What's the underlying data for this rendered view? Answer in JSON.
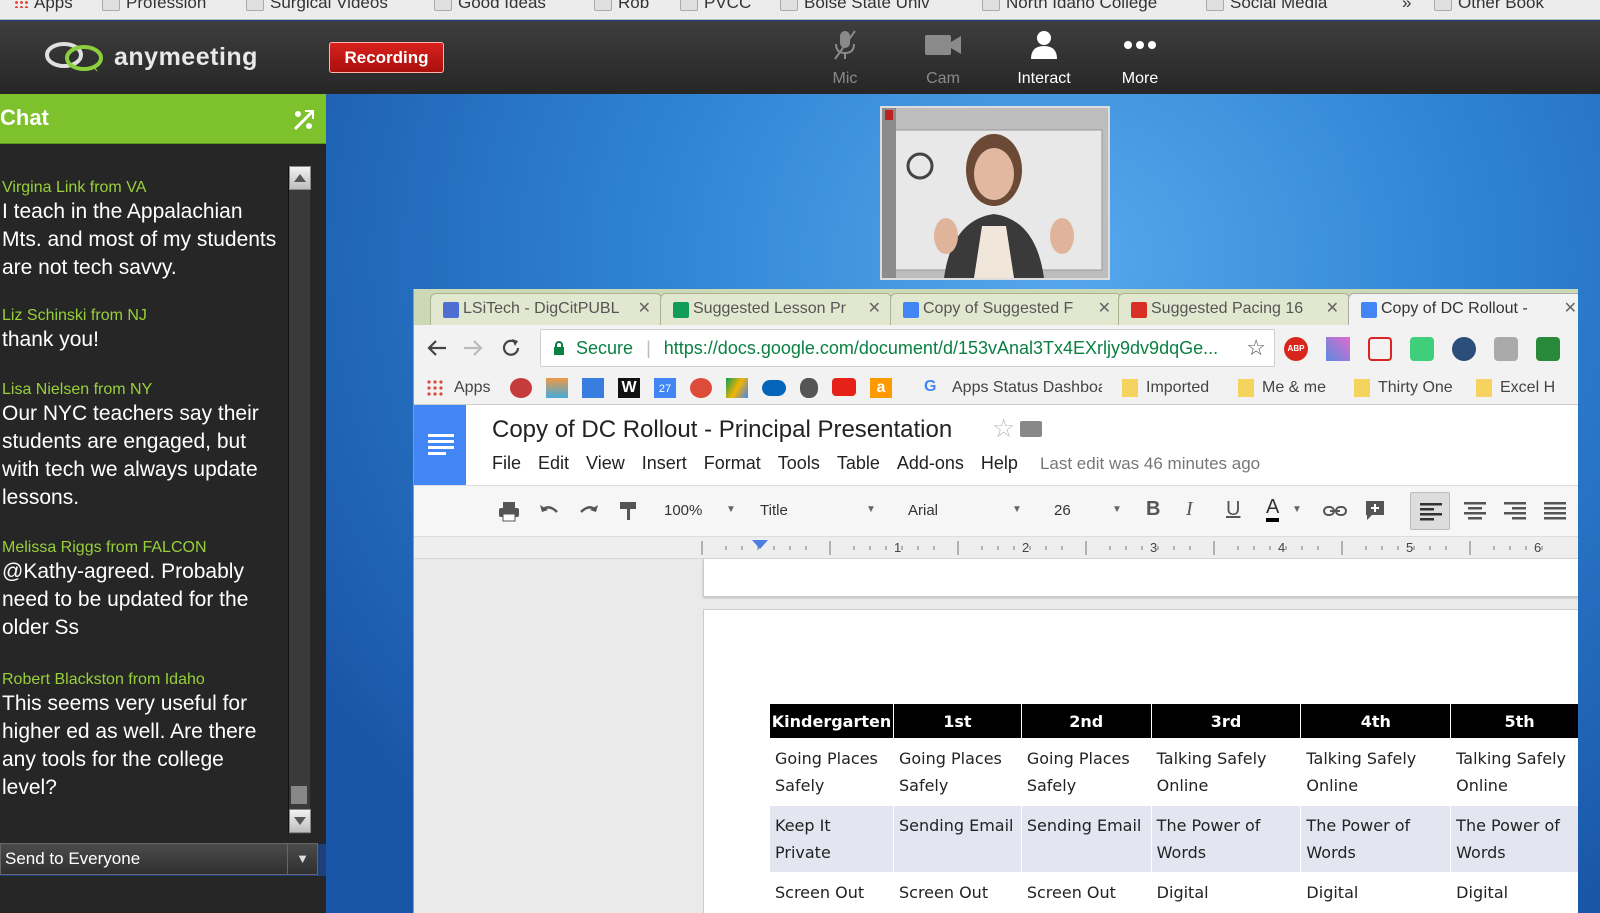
{
  "bookmarks_top": [
    "Apps",
    "Profession",
    "Surgical Videos",
    "Good Ideas",
    "Rob",
    "PVCC",
    "Boise State Univ",
    "North Idaho College",
    "Social Media",
    "»",
    "Other Book"
  ],
  "app": {
    "name": "anymeeting",
    "recording_label": "Recording"
  },
  "toolbar_buttons": [
    {
      "label": "Mic",
      "icon": "mic-muted-icon",
      "state": "disabled"
    },
    {
      "label": "Cam",
      "icon": "camera-icon",
      "state": "disabled"
    },
    {
      "label": "Interact",
      "icon": "person-icon",
      "state": "active"
    },
    {
      "label": "More",
      "icon": "more-dots-icon",
      "state": "active"
    }
  ],
  "chat": {
    "title": "Chat",
    "messages": [
      {
        "from": "Virgina Link from VA",
        "text": "I teach in the Appalachian Mts. and most of my students are not tech savvy."
      },
      {
        "from": "Liz Schinski from NJ",
        "text": "thank you!"
      },
      {
        "from": "Lisa  Nielsen from NY",
        "text": "Our NYC teachers say their students are engaged, but with tech we always update lessons."
      },
      {
        "from": "Melissa Riggs from FALCON",
        "text": "@Kathy-agreed. Probably need to be updated for the older Ss"
      },
      {
        "from": "Robert Blackston from Idaho",
        "text": "This seems very useful for higher ed as well. Are there any tools for the college level?"
      }
    ],
    "send_to": "Send to Everyone"
  },
  "browser": {
    "tabs": [
      {
        "label": "LSiTech - DigCitPUBL",
        "icon_color": "#4c6fd1"
      },
      {
        "label": "Suggested Lesson Pr",
        "icon_color": "#0f9d58"
      },
      {
        "label": "Copy of Suggested F",
        "icon_color": "#4285f4"
      },
      {
        "label": "Suggested Pacing 16",
        "icon_color": "#d93025"
      },
      {
        "label": "Copy of DC Rollout -",
        "icon_color": "#4285f4"
      }
    ],
    "secure_label": "Secure",
    "url": "https://docs.google.com/document/d/153vAnal3Tx4EXrljy9dv9dqGe...",
    "bookmarks": {
      "apps": "Apps",
      "apps_status": "Apps Status Dashboa",
      "imported": "Imported",
      "me": "Me & me",
      "thirty": "Thirty One",
      "excel": "Excel H"
    },
    "doc": {
      "title": "Copy of DC Rollout - Principal Presentation",
      "menus": [
        "File",
        "Edit",
        "View",
        "Insert",
        "Format",
        "Tools",
        "Table",
        "Add-ons",
        "Help"
      ],
      "last_edit": "Last edit was 46 minutes ago",
      "zoom": "100%",
      "style": "Title",
      "font": "Arial",
      "size": "26",
      "ruler_numbers": [
        "1",
        "2",
        "3",
        "4",
        "5",
        "6"
      ],
      "table": {
        "headers": [
          "Kindergarten",
          "1st",
          "2nd",
          "3rd",
          "4th",
          "5th"
        ],
        "rows": [
          [
            "Going Places Safely",
            "Going Places Safely",
            "Going Places Safely",
            "Talking Safely Online",
            "Talking Safely Online",
            "Talking Safely Online"
          ],
          [
            "Keep It Private",
            "Sending Email",
            "Sending Email",
            "The Power of Words",
            "The Power of Words",
            "The Power of Words"
          ],
          [
            "Screen Out",
            "Screen Out",
            "Screen Out",
            "Digital",
            "Digital",
            "Digital"
          ]
        ]
      }
    }
  }
}
